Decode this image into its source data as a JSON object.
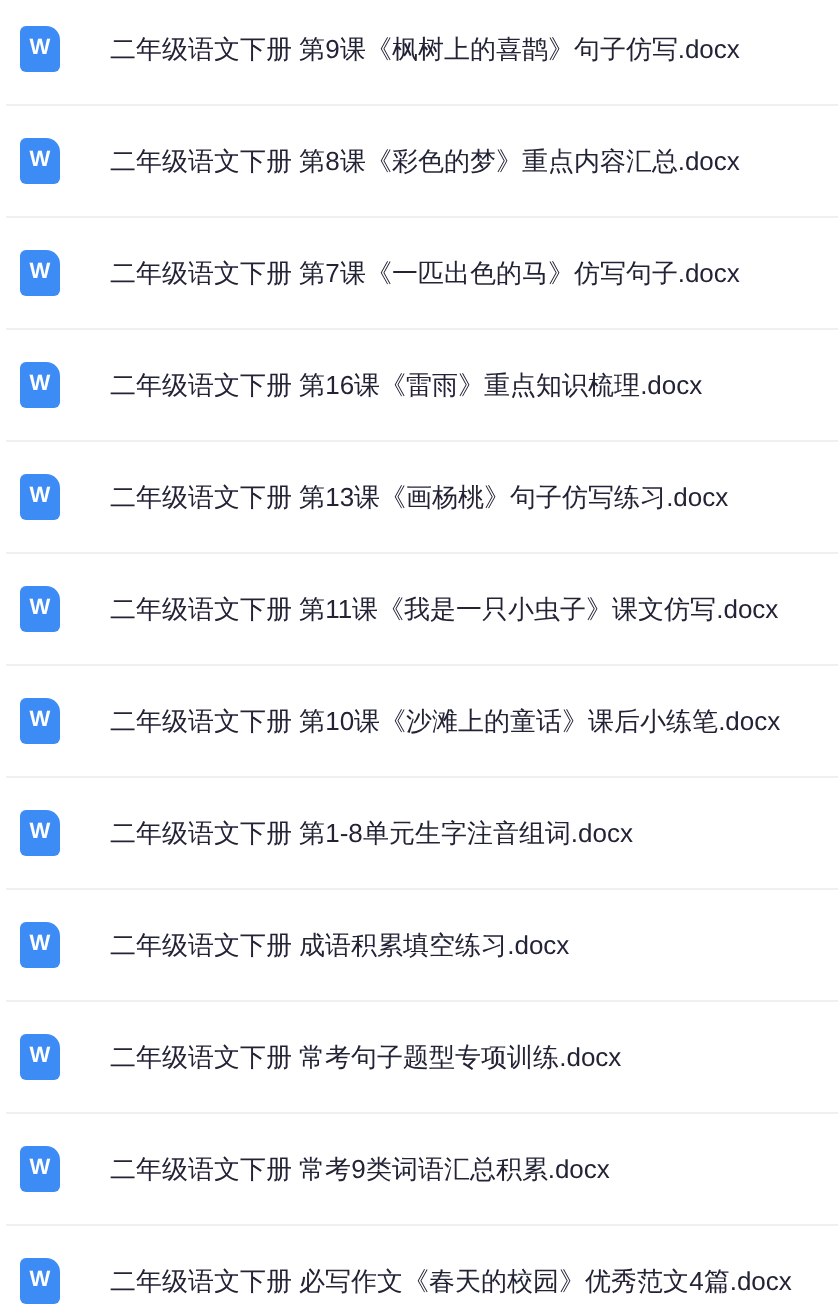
{
  "files": [
    {
      "icon": "W",
      "name": "二年级语文下册 第9课《枫树上的喜鹊》句子仿写.docx"
    },
    {
      "icon": "W",
      "name": "二年级语文下册 第8课《彩色的梦》重点内容汇总.docx"
    },
    {
      "icon": "W",
      "name": "二年级语文下册 第7课《一匹出色的马》仿写句子.docx"
    },
    {
      "icon": "W",
      "name": "二年级语文下册 第16课《雷雨》重点知识梳理.docx"
    },
    {
      "icon": "W",
      "name": "二年级语文下册 第13课《画杨桃》句子仿写练习.docx"
    },
    {
      "icon": "W",
      "name": "二年级语文下册 第11课《我是一只小虫子》课文仿写.docx"
    },
    {
      "icon": "W",
      "name": "二年级语文下册 第10课《沙滩上的童话》课后小练笔.docx"
    },
    {
      "icon": "W",
      "name": "二年级语文下册 第1-8单元生字注音组词.docx"
    },
    {
      "icon": "W",
      "name": "二年级语文下册 成语积累填空练习.docx"
    },
    {
      "icon": "W",
      "name": "二年级语文下册 常考句子题型专项训练.docx"
    },
    {
      "icon": "W",
      "name": "二年级语文下册 常考9类词语汇总积累.docx"
    },
    {
      "icon": "W",
      "name": "二年级语文下册 必写作文《春天的校园》优秀范文4篇.docx"
    }
  ]
}
